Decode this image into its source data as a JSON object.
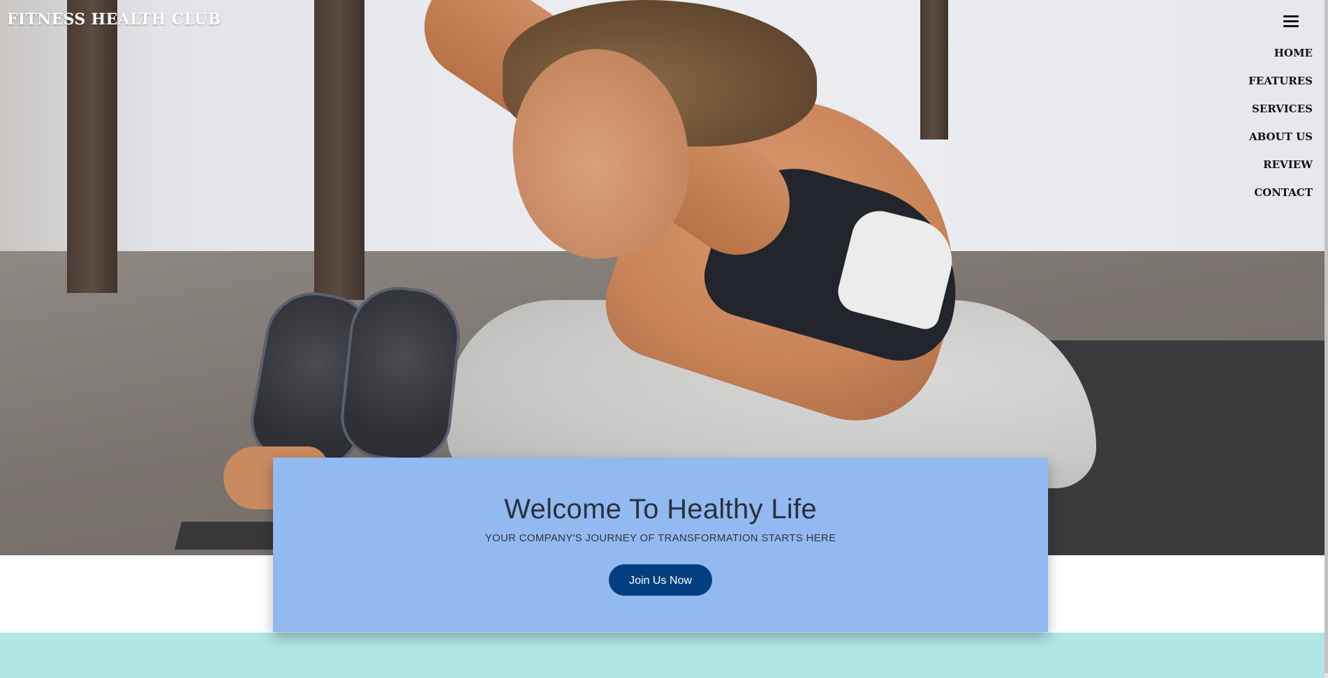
{
  "header": {
    "brand": "FITNESS HEALTH CLUB",
    "menu_icon": "hamburger-menu-icon",
    "nav": [
      {
        "label": "HOME"
      },
      {
        "label": "FEATURES"
      },
      {
        "label": "SERVICES"
      },
      {
        "label": "ABOUT US"
      },
      {
        "label": "REVIEW"
      },
      {
        "label": "CONTACT"
      }
    ]
  },
  "hero": {
    "title": "Welcome To Healthy Life",
    "subtitle": "YOUR COMPANY'S JOURNEY OF TRANSFORMATION STARTS HERE",
    "cta_label": "Join Us Now"
  },
  "colors": {
    "card_background": "#92b9f0",
    "cta_background": "#033f80",
    "band_background": "#b1e6e7"
  }
}
